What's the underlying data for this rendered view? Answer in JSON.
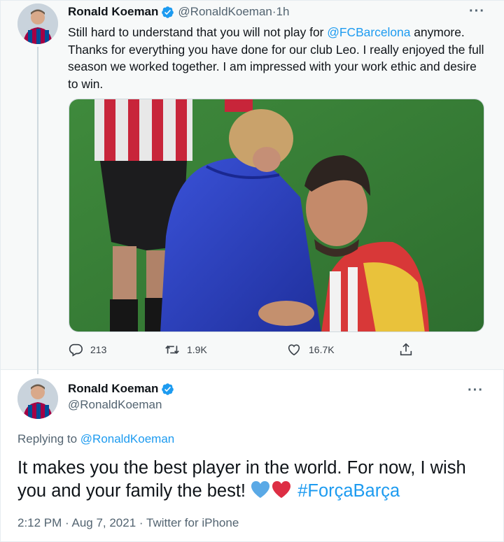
{
  "tweet1": {
    "author_name": "Ronald Koeman",
    "handle": "@RonaldKoeman",
    "separator": " · ",
    "time": "1h",
    "more_label": "···",
    "text_before_mention": "Still hard to understand that you will not play for ",
    "mention": "@FCBarcelona",
    "text_after_mention": " anymore. Thanks for everything you have done for our club Leo. I really enjoyed the full season we worked together. I am impressed with your work ethic and desire to win.",
    "metrics": {
      "replies": "213",
      "retweets": "1.9K",
      "likes": "16.7K"
    }
  },
  "tweet2": {
    "author_name": "Ronald Koeman",
    "handle": "@RonaldKoeman",
    "more_label": "···",
    "replying_prefix": "Replying to ",
    "replying_to": "@RonaldKoeman",
    "text": "It makes you the best player in the world. For now, I wish you and your family the best! ",
    "hashtag": "#ForçaBarça",
    "emojis": [
      "blue-heart-icon",
      "red-heart-icon"
    ],
    "time": "2:12 PM",
    "date": "Aug 7, 2021",
    "client": "Twitter for iPhone",
    "meta_separator": " · "
  },
  "colors": {
    "accent": "#1d9bf0",
    "text": "#0f1419",
    "secondary": "#536471",
    "verified": "#1d9bf0",
    "blue_heart": "#5aa9e6",
    "red_heart": "#dd2e44"
  }
}
